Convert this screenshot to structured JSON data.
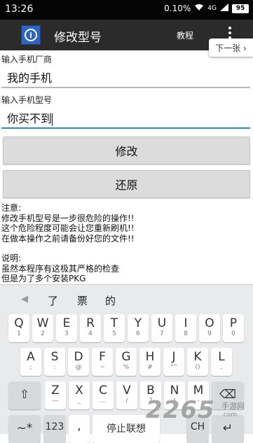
{
  "status": {
    "time": "13:26",
    "speed": "0.10%",
    "signal": "4G",
    "battery": "95"
  },
  "actionbar": {
    "title": "修改型号",
    "tutorial": "教程",
    "icon": "info-icon"
  },
  "tip": {
    "next": "下一张 ›"
  },
  "form": {
    "vendor_label": "输入手机厂商",
    "vendor_value": "我的手机",
    "model_label": "输入手机型号",
    "model_value": "你买不到"
  },
  "buttons": {
    "modify": "修改",
    "restore": "还原"
  },
  "notes": {
    "line1": "注意:",
    "line2": "修改手机型号是一步很危险的操作!!",
    "line3": "这个危险程度可能会让您重新刷机!!",
    "line4": "在做本操作之前请备份好您的文件!!",
    "line5": "说明:",
    "line6": "虽然本程序有这极其严格的检查",
    "line7": "但是为了多个安装PKG"
  },
  "keyboard": {
    "candidates": [
      "了",
      "票",
      "的"
    ],
    "row1": [
      [
        "Q",
        "1"
      ],
      [
        "W",
        "2"
      ],
      [
        "E",
        "3"
      ],
      [
        "R",
        "4"
      ],
      [
        "T",
        "5"
      ],
      [
        "Y",
        "6"
      ],
      [
        "U",
        "7"
      ],
      [
        "I",
        "8"
      ],
      [
        "O",
        "9"
      ],
      [
        "P",
        "0"
      ]
    ],
    "row2": [
      [
        "A",
        ";"
      ],
      [
        "S",
        ":"
      ],
      [
        "D",
        "@"
      ],
      [
        "F",
        "~"
      ],
      [
        "G",
        "%"
      ],
      [
        "H",
        "#"
      ],
      [
        "J",
        "“”"
      ],
      [
        "K",
        "()"
      ],
      [
        "L",
        ","
      ]
    ],
    "row3": [
      [
        "Z",
        "—"
      ],
      [
        "X",
        "_"
      ],
      [
        "C",
        "…"
      ],
      [
        "V",
        "/"
      ],
      [
        "B",
        "?"
      ],
      [
        "N",
        "!"
      ],
      [
        "M",
        "-"
      ]
    ],
    "symbols_key": "~*",
    "numbers_key": "123",
    "space_label": "停止联想",
    "lang_key": "CH"
  },
  "watermark": {
    "brand": "2265",
    "dot_com": ".com",
    "site": "手游网"
  }
}
